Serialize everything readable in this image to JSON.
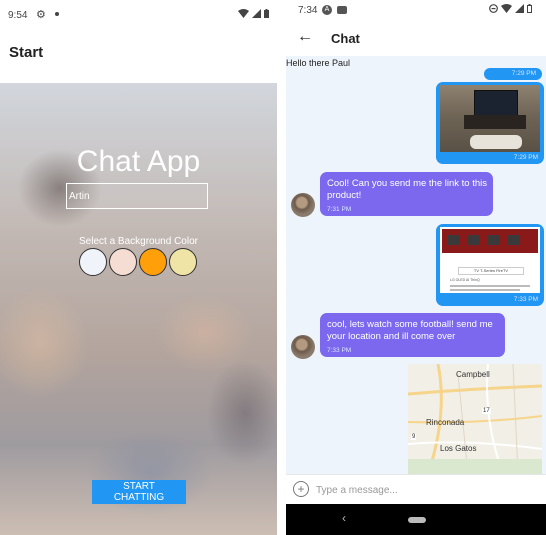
{
  "left_screen": {
    "status_bar": {
      "time": "9:54"
    },
    "appbar": {
      "title": "Start"
    },
    "title": "Chat App",
    "name_input": {
      "value": "Artin"
    },
    "color_label": "Select a Background Color",
    "swatches": [
      {
        "color": "#f0f3f9"
      },
      {
        "color": "#f6ddd3"
      },
      {
        "color": "#ff9f0a"
      },
      {
        "color": "#efe3a5"
      }
    ],
    "start_button": "START CHATTING"
  },
  "right_screen": {
    "status_bar": {
      "time": "7:34"
    },
    "appbar": {
      "title": "Chat"
    },
    "messages": [
      {
        "text": "Hello there Paul"
      },
      {
        "time": "7:29 PM"
      },
      {
        "time": "7:29 PM"
      },
      {
        "text": "Cool! Can you send me the link to this product!",
        "time": "7:31 PM"
      },
      {
        "time": "7:33 PM",
        "image_text": "TV T-Series FireTV",
        "image_subtext": "LG OLED AI ThinQ"
      },
      {
        "text": "cool, lets watch some football! send me your location and ill come over",
        "time": "7:33 PM"
      }
    ],
    "map": {
      "labels": [
        "Campbell",
        "Rinconada",
        "Los Gatos"
      ],
      "road_numbers": [
        "9",
        "17"
      ]
    },
    "composer": {
      "placeholder": "Type a message..."
    }
  }
}
